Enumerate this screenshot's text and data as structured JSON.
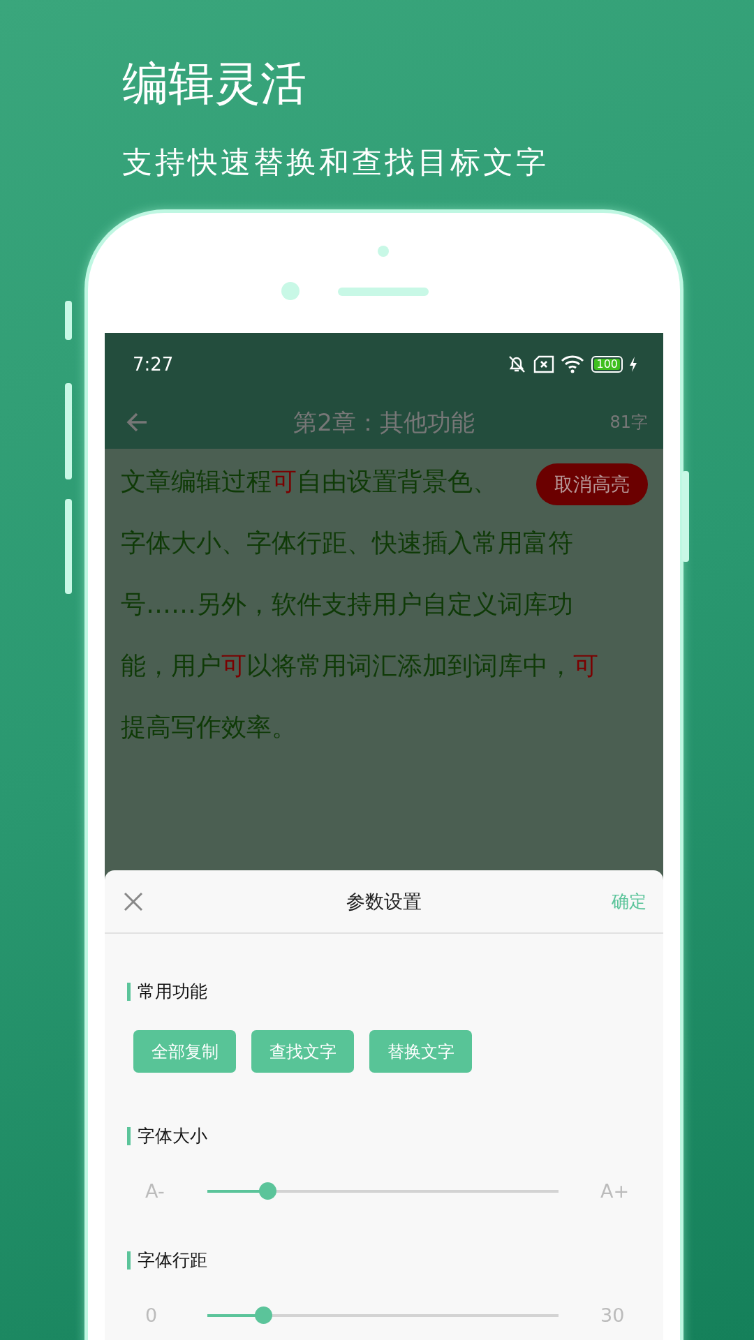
{
  "header": {
    "title": "编辑灵活",
    "subtitle": "支持快速替换和查找目标文字"
  },
  "status_bar": {
    "time": "7:27",
    "battery": "100"
  },
  "toolbar": {
    "title": "第2章：其他功能",
    "word_count": "81字"
  },
  "editor": {
    "lines": [
      [
        {
          "text": "文章编辑过程",
          "highlighted": false
        },
        {
          "text": "可",
          "highlighted": true
        },
        {
          "text": "自由设置背景色、",
          "highlighted": false
        }
      ],
      [
        {
          "text": "字体大小、字体行距、快速插入常用富符",
          "highlighted": false
        }
      ],
      [
        {
          "text": "号……另外，软件支持用户自定义词库功",
          "highlighted": false
        }
      ],
      [
        {
          "text": "能，用户",
          "highlighted": false
        },
        {
          "text": "可",
          "highlighted": true
        },
        {
          "text": "以将常用词汇添加到词库中，",
          "highlighted": false
        },
        {
          "text": "可",
          "highlighted": true
        }
      ],
      [
        {
          "text": "提高写作效率。",
          "highlighted": false
        }
      ]
    ],
    "highlight_button": "取消高亮"
  },
  "sheet": {
    "title": "参数设置",
    "confirm": "确定",
    "sections": [
      {
        "kind": "buttons",
        "title": "常用功能",
        "buttons": [
          "全部复制",
          "查找文字",
          "替换文字"
        ]
      },
      {
        "kind": "slider",
        "title": "字体大小",
        "min_label": "A-",
        "max_label": "A+",
        "level": 0.17
      },
      {
        "kind": "slider",
        "title": "字体行距",
        "min_label": "0",
        "max_label": "30",
        "level": 0.16
      }
    ]
  }
}
